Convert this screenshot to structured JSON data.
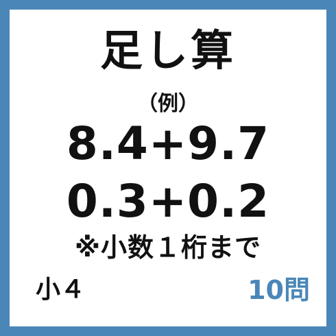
{
  "card": {
    "title": "足し算",
    "example_label": "（例）",
    "problems": [
      "8.4+9.7",
      "0.3+0.2"
    ],
    "note": "※小数１桁まで",
    "grade": "小４",
    "count": "10問"
  },
  "colors": {
    "border": "#4a86b8",
    "count_text": "#4a86b8",
    "text": "#111111",
    "background": "#ffffff"
  }
}
